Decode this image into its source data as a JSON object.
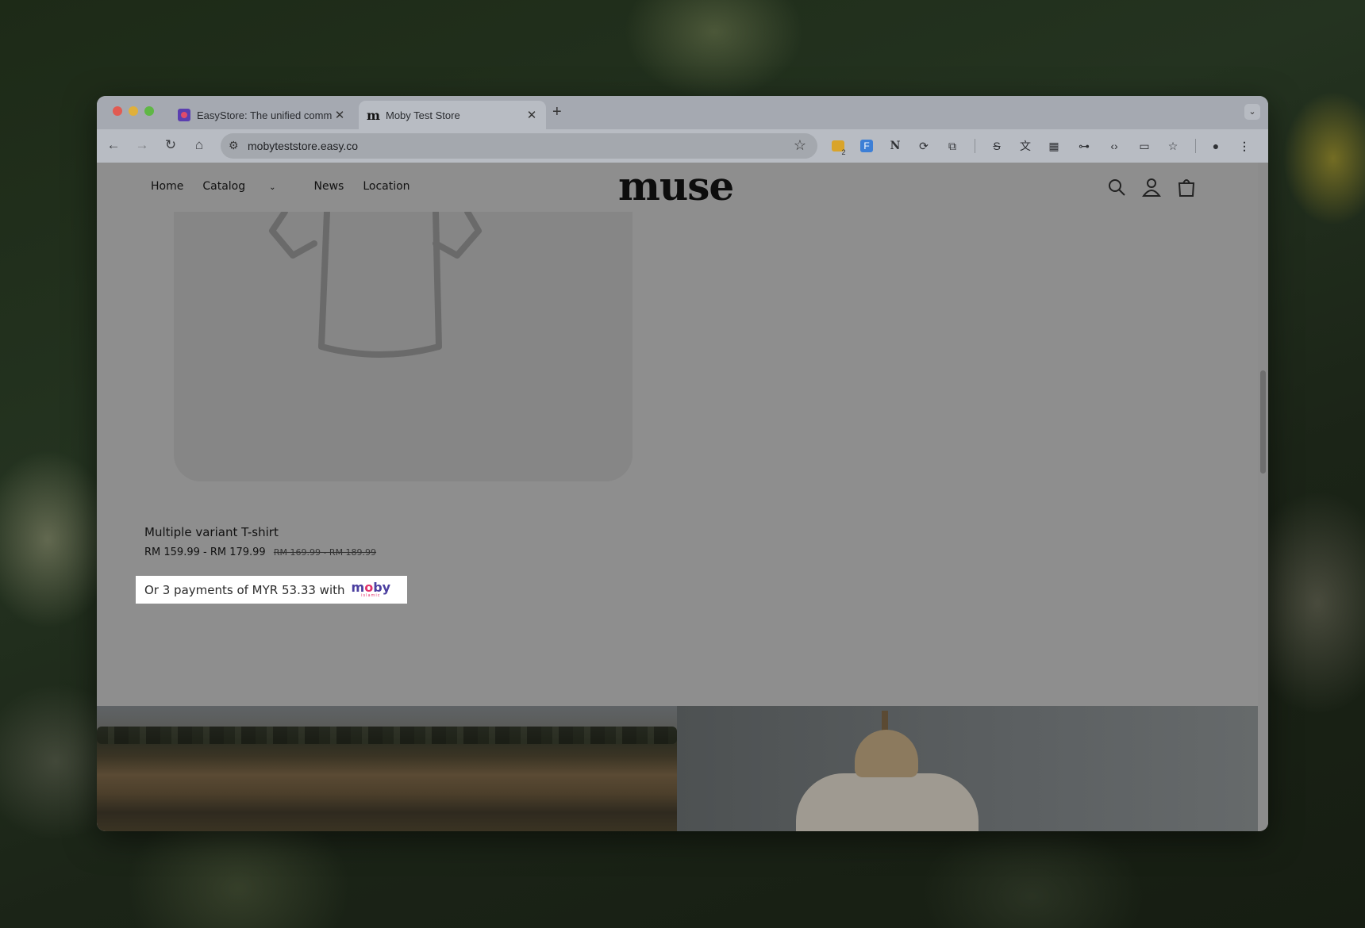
{
  "browser": {
    "tabs": [
      {
        "title": "EasyStore: The unified comm",
        "icon": "easystore-favicon",
        "active": false
      },
      {
        "title": "Moby Test Store",
        "icon": "m-favicon",
        "active": true
      }
    ],
    "url": "mobyteststore.easy.co",
    "extension_badge": "2"
  },
  "store": {
    "logo": "muse",
    "nav": {
      "home": "Home",
      "catalog": "Catalog",
      "news": "News",
      "location": "Location"
    }
  },
  "product": {
    "title": "Multiple variant T-shirt",
    "price": "RM 159.99 - RM 179.99",
    "compare_price": "RM 169.99 - RM 189.99"
  },
  "moby": {
    "message": "Or 3 payments of MYR 53.33 with",
    "logo_pre": "m",
    "logo_o": "o",
    "logo_post": "by",
    "logo_sub": "islamic"
  },
  "colors": {
    "overlay_page": "#8e8e8e",
    "moby_primary": "#4b3fa0",
    "moby_accent": "#e2336b"
  }
}
